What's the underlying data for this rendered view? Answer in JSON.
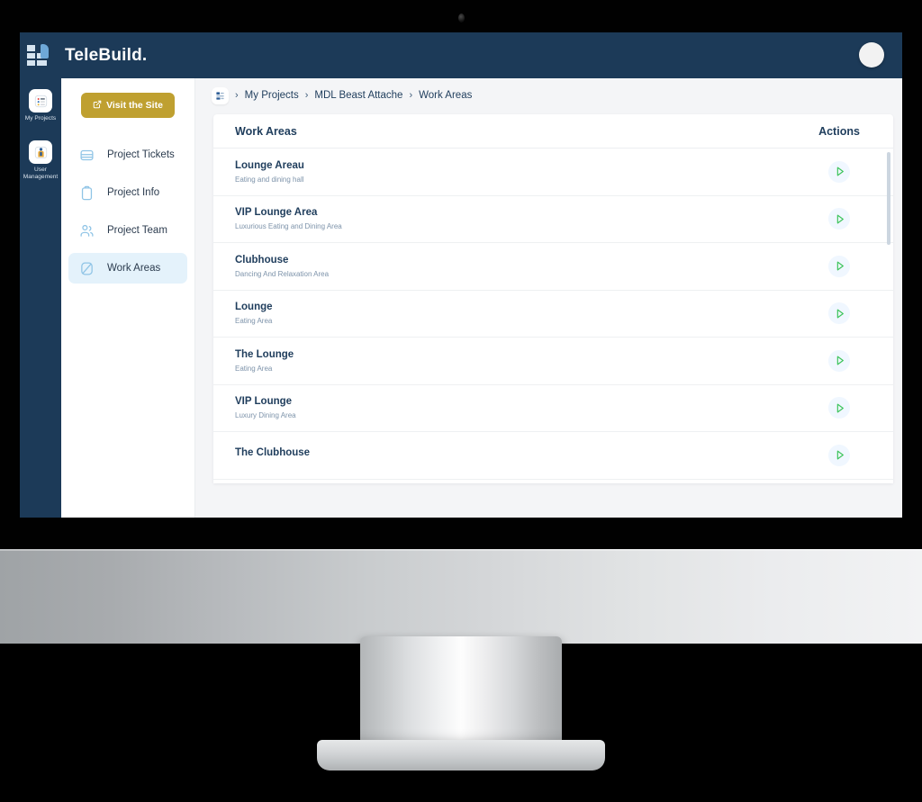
{
  "app": {
    "brand_name": "TeleBuild.",
    "logo_icon": "building-blocks-icon",
    "avatar_icon": "user-avatar"
  },
  "icon_rail": {
    "items": [
      {
        "label": "My Projects",
        "icon": "projects-list-icon",
        "glyph": "☰",
        "active": true
      },
      {
        "label": "User Management",
        "icon": "user-management-icon",
        "glyph": "⛭",
        "active": false
      }
    ]
  },
  "subnav": {
    "visit_site_label": "Visit the Site",
    "visit_site_icon": "external-link-icon",
    "items": [
      {
        "label": "Project Tickets",
        "icon": "ticket-icon",
        "active": false
      },
      {
        "label": "Project Info",
        "icon": "clipboard-icon",
        "active": false
      },
      {
        "label": "Project Team",
        "icon": "people-icon",
        "active": false
      },
      {
        "label": "Work Areas",
        "icon": "work-area-icon",
        "active": true
      }
    ]
  },
  "breadcrumb": {
    "badge_icon": "site-map-icon",
    "separator": "›",
    "crumbs": [
      "My Projects",
      "MDL Beast Attache",
      "Work Areas"
    ]
  },
  "table": {
    "columns": [
      "Work Areas",
      "Actions"
    ],
    "action_icon": "play-icon",
    "rows": [
      {
        "title": "Lounge Areau",
        "subtitle": "Eating and dining hall"
      },
      {
        "title": "VIP Lounge Area",
        "subtitle": "Luxurious Eating and Dining Area"
      },
      {
        "title": "Clubhouse",
        "subtitle": "Dancing And Relaxation Area"
      },
      {
        "title": "Lounge",
        "subtitle": "Eating Area"
      },
      {
        "title": "The Lounge",
        "subtitle": "Eating Area"
      },
      {
        "title": "VIP Lounge",
        "subtitle": "Luxury Dining Area"
      },
      {
        "title": "The Clubhouse",
        "subtitle": ""
      }
    ]
  },
  "colors": {
    "topbar": "#1c3a58",
    "accent_gold": "#bfa030",
    "action_green": "#3ec45c",
    "page_bg": "#f4f5f7",
    "active_nav": "#e4f2fb",
    "nav_icon": "#8fc4e6",
    "text_dark": "#1f3d5c",
    "text_muted": "#7d93aa"
  }
}
